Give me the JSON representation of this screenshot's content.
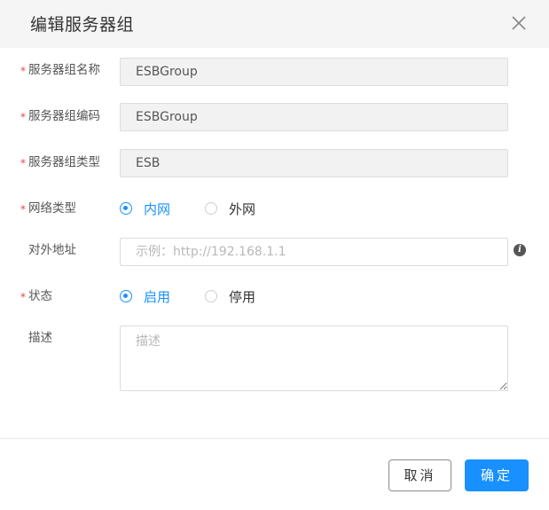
{
  "dialog": {
    "title": "编辑服务器组",
    "close_icon": "close-icon"
  },
  "form": {
    "required_mark": "*",
    "group_name": {
      "label": "服务器组名称",
      "value": "ESBGroup",
      "required": true
    },
    "group_code": {
      "label": "服务器组编码",
      "value": "ESBGroup",
      "required": true
    },
    "group_type": {
      "label": "服务器组类型",
      "value": "ESB",
      "required": true
    },
    "network_type": {
      "label": "网络类型",
      "required": true,
      "options": [
        {
          "label": "内网",
          "selected": true
        },
        {
          "label": "外网",
          "selected": false
        }
      ]
    },
    "external_address": {
      "label": "对外地址",
      "value": "",
      "placeholder": "示例：http://192.168.1.1",
      "info_icon": "info-icon"
    },
    "status": {
      "label": "状态",
      "required": true,
      "options": [
        {
          "label": "启用",
          "selected": true
        },
        {
          "label": "停用",
          "selected": false
        }
      ]
    },
    "description": {
      "label": "描述",
      "value": "",
      "placeholder": "描述"
    }
  },
  "footer": {
    "cancel_label": "取消",
    "ok_label": "确定"
  },
  "colors": {
    "accent": "#1890ff",
    "required": "#ee4444",
    "header_bg": "#f5f5f5",
    "disabled_bg": "#f2f2f2"
  }
}
